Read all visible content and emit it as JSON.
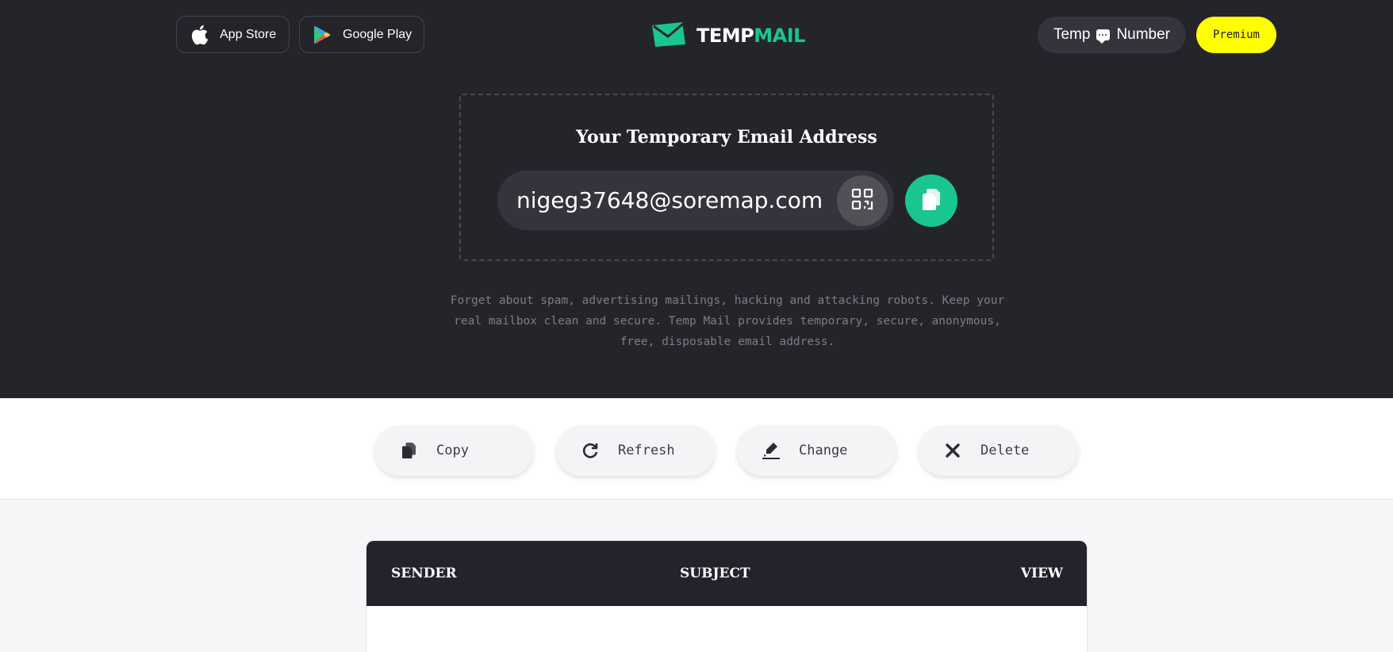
{
  "header": {
    "app_store_label": "App Store",
    "google_play_label": "Google Play",
    "logo_part1": "TEMP",
    "logo_part2": "MAIL",
    "temp_number_left": "Temp",
    "temp_number_right": "Number",
    "premium_label": "Premium"
  },
  "email": {
    "title": "Your Temporary Email Address",
    "address": "nigeg37648@soremap.com"
  },
  "tagline": "Forget about spam, advertising mailings, hacking and attacking robots. Keep your real mailbox clean and secure. Temp Mail provides temporary, secure, anonymous, free, disposable email address.",
  "actions": {
    "copy": "Copy",
    "refresh": "Refresh",
    "change": "Change",
    "delete": "Delete"
  },
  "inbox": {
    "columns": [
      "SENDER",
      "SUBJECT",
      "VIEW"
    ]
  },
  "colors": {
    "accent": "#19c690",
    "premium": "#ffff00",
    "dark_bg": "#24242b"
  }
}
